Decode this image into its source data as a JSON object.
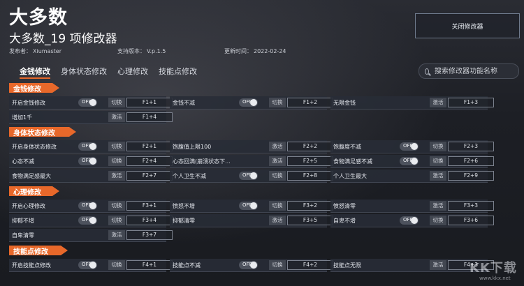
{
  "app": {
    "title": "大多数",
    "subtitle": "大多数_19 项修改器",
    "publisher_label": "发布者：",
    "publisher": "Xiumaster",
    "version_label": "支持版本：",
    "version": "V.p.1.5",
    "updated_label": "更新时间：",
    "updated": "2022-02-24",
    "close_label": "关闭修改器"
  },
  "tabs": [
    {
      "label": "金钱修改",
      "active": true
    },
    {
      "label": "身体状态修改",
      "active": false
    },
    {
      "label": "心理修改",
      "active": false
    },
    {
      "label": "技能点修改",
      "active": false
    }
  ],
  "search": {
    "placeholder": "搜索修改器功能名称"
  },
  "toggle_text": "OFF",
  "sections": [
    {
      "title": "金钱修改",
      "rows": [
        [
          {
            "label": "开启金钱修改",
            "toggle": true,
            "action": "切换",
            "hotkey": "F1+1"
          },
          {
            "label": "金钱不减",
            "toggle": true,
            "action": "切换",
            "hotkey": "F1+2"
          },
          {
            "label": "无限金钱",
            "toggle": false,
            "action": "激活",
            "hotkey": "F1+3"
          }
        ],
        [
          {
            "label": "增加1千",
            "toggle": false,
            "action": "激活",
            "hotkey": "F1+4"
          }
        ]
      ]
    },
    {
      "title": "身体状态修改",
      "rows": [
        [
          {
            "label": "开启身体状态修改",
            "toggle": true,
            "action": "切换",
            "hotkey": "F2+1"
          },
          {
            "label": "饱腹值上限100",
            "toggle": false,
            "action": "激活",
            "hotkey": "F2+2"
          },
          {
            "label": "饱腹度不减",
            "toggle": true,
            "action": "切换",
            "hotkey": "F2+3"
          }
        ],
        [
          {
            "label": "心态不减",
            "toggle": true,
            "action": "切换",
            "hotkey": "F2+4"
          },
          {
            "label": "心态回满(崩溃状态下...",
            "toggle": false,
            "action": "激活",
            "hotkey": "F2+5"
          },
          {
            "label": "食物满足感不减",
            "toggle": true,
            "action": "切换",
            "hotkey": "F2+6"
          }
        ],
        [
          {
            "label": "食物满足感最大",
            "toggle": false,
            "action": "激活",
            "hotkey": "F2+7"
          },
          {
            "label": "个人卫生不减",
            "toggle": true,
            "action": "切换",
            "hotkey": "F2+8"
          },
          {
            "label": "个人卫生最大",
            "toggle": false,
            "action": "激活",
            "hotkey": "F2+9"
          }
        ]
      ]
    },
    {
      "title": "心理修改",
      "rows": [
        [
          {
            "label": "开启心理修改",
            "toggle": true,
            "action": "切换",
            "hotkey": "F3+1"
          },
          {
            "label": "愤怒不增",
            "toggle": true,
            "action": "切换",
            "hotkey": "F3+2"
          },
          {
            "label": "愤怒清零",
            "toggle": false,
            "action": "激活",
            "hotkey": "F3+3"
          }
        ],
        [
          {
            "label": "抑郁不增",
            "toggle": true,
            "action": "切换",
            "hotkey": "F3+4"
          },
          {
            "label": "抑郁清零",
            "toggle": false,
            "action": "激活",
            "hotkey": "F3+5"
          },
          {
            "label": "自卑不增",
            "toggle": true,
            "action": "切换",
            "hotkey": "F3+6"
          }
        ],
        [
          {
            "label": "自卑清零",
            "toggle": false,
            "action": "激活",
            "hotkey": "F3+7"
          }
        ]
      ]
    },
    {
      "title": "技能点修改",
      "rows": [
        [
          {
            "label": "开启技能点修改",
            "toggle": true,
            "action": "切换",
            "hotkey": "F4+1"
          },
          {
            "label": "技能点不减",
            "toggle": true,
            "action": "切换",
            "hotkey": "F4+2"
          },
          {
            "label": "技能点无限",
            "toggle": false,
            "action": "激活",
            "hotkey": "F4+3"
          }
        ]
      ]
    }
  ],
  "watermark": {
    "mark": "KK下载",
    "url": "www.kkx.net"
  }
}
